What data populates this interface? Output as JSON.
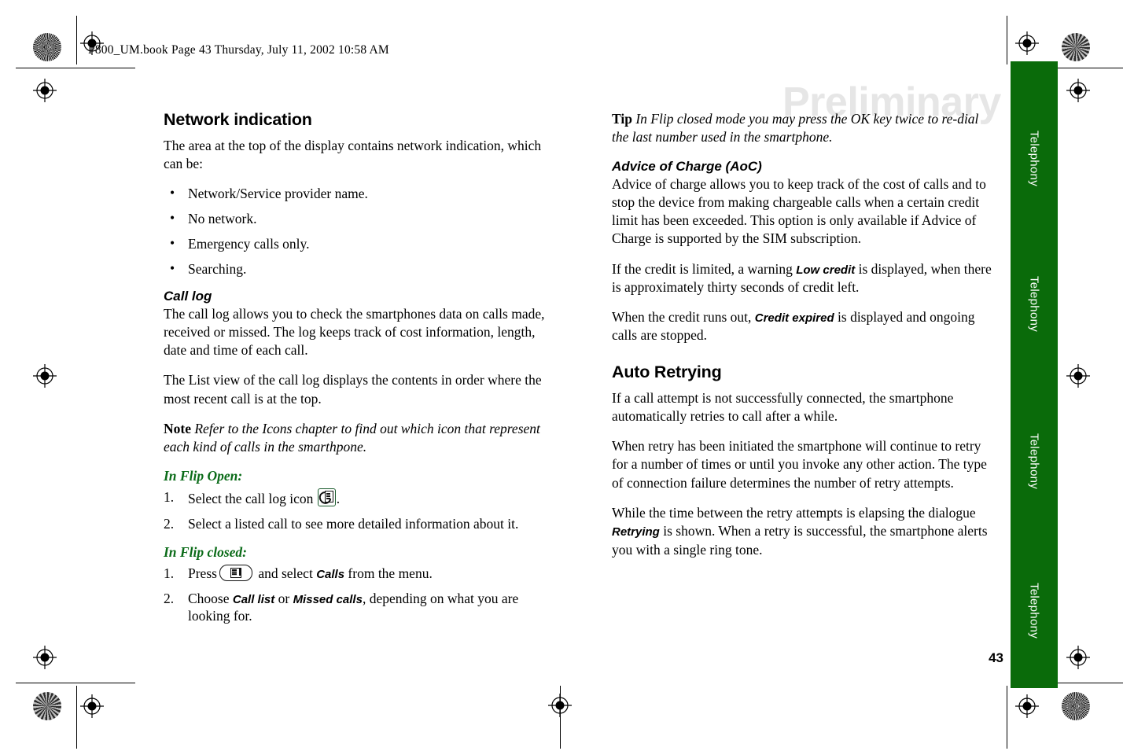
{
  "document": {
    "header_line": "P800_UM.book  Page 43  Thursday, July 11, 2002  10:58 AM",
    "watermark": "Preliminary",
    "page_number": "43",
    "side_tab_label": "Telephony",
    "accent_green": "#0a6b0a",
    "heading_green": "#0a6b18",
    "watermark_color": "#e6e6e6"
  },
  "left_column": {
    "network_indication": {
      "heading": "Network indication",
      "intro": "The area at the top of the display contains network indication, which can be:",
      "bullets": [
        "Network/Service provider name.",
        "No network.",
        "Emergency calls only.",
        "Searching."
      ]
    },
    "call_log": {
      "heading": "Call log",
      "paragraph_1": "The call log allows you to check the smartphones data on calls made, received or missed. The log keeps track of cost information, length, date and time of each call.",
      "paragraph_2": "The List view of the call log displays the contents in order where the most recent call is at the top.",
      "note_lead": "Note",
      "note_text": "Refer to the Icons chapter to find out which icon that represent each kind of calls in the smarthpone."
    },
    "flip_open": {
      "heading": "In Flip Open:",
      "step_1_before_icon": "Select the call log icon",
      "step_1_icon": "call-log-icon",
      "step_1_after_icon": ".",
      "step_2": "Select a listed call to see more detailed information about it."
    },
    "flip_closed": {
      "heading": "In Flip closed:",
      "step_1_before_key": "Press",
      "step_1_key_icon": "menu-key-icon",
      "step_1_mid": " and select ",
      "step_1_term": "Calls",
      "step_1_after": " from the menu.",
      "step_2_before": "Choose ",
      "step_2_term_a": "Call list",
      "step_2_mid": " or ",
      "step_2_term_b": "Missed calls",
      "step_2_after": ", depending on what you are looking for."
    }
  },
  "right_column": {
    "tip": {
      "lead": "Tip",
      "text": "In Flip closed mode you may press the OK key twice to re-dial the last number used in the smartphone."
    },
    "advice_of_charge": {
      "heading": "Advice of Charge (AoC)",
      "paragraph_1": "Advice of charge allows you to keep track of the cost of calls and to stop the device from making chargeable calls when a certain credit limit has been exceeded. This option is only available if Advice of Charge is supported by the SIM subscription.",
      "paragraph_2_before": "If the credit is limited, a warning ",
      "paragraph_2_term": "Low credit",
      "paragraph_2_after": " is displayed, when there is approximately thirty seconds of credit left.",
      "paragraph_3_before": "When the credit runs out, ",
      "paragraph_3_term": "Credit expired",
      "paragraph_3_after": " is displayed and ongoing calls are stopped."
    },
    "auto_retrying": {
      "heading": "Auto Retrying",
      "paragraph_1": "If a call attempt is not successfully connected, the smartphone automatically retries to call after a while.",
      "paragraph_2": "When retry has been initiated the smartphone will continue to retry for a number of times or until you invoke any other action. The type of connection failure determines the number of retry attempts.",
      "paragraph_3_before": "While the time between the retry attempts is elapsing the dialogue ",
      "paragraph_3_term": "Retrying",
      "paragraph_3_after": " is shown. When a retry is successful, the smartphone alerts you with a single ring tone."
    }
  }
}
